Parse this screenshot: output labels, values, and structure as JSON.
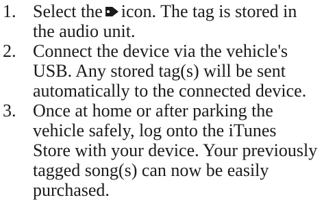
{
  "steps": [
    {
      "number": "1.",
      "lines": [
        {
          "before_icon": "Select the",
          "icon": "tag-icon",
          "after_icon": "icon. The tag is stored in"
        },
        {
          "text": "the audio unit."
        }
      ]
    },
    {
      "number": "2.",
      "lines": [
        {
          "text": "Connect the device via the vehicle's"
        },
        {
          "text": "USB. Any stored tag(s) will be sent"
        },
        {
          "text": "automatically to the connected device."
        }
      ]
    },
    {
      "number": "3.",
      "lines": [
        {
          "text": "Once at home or after parking the"
        },
        {
          "text": "vehicle safely, log onto the iTunes"
        },
        {
          "text": "Store with your device. Your previously"
        },
        {
          "text": "tagged song(s) can now be easily"
        },
        {
          "text": "purchased."
        }
      ]
    }
  ]
}
